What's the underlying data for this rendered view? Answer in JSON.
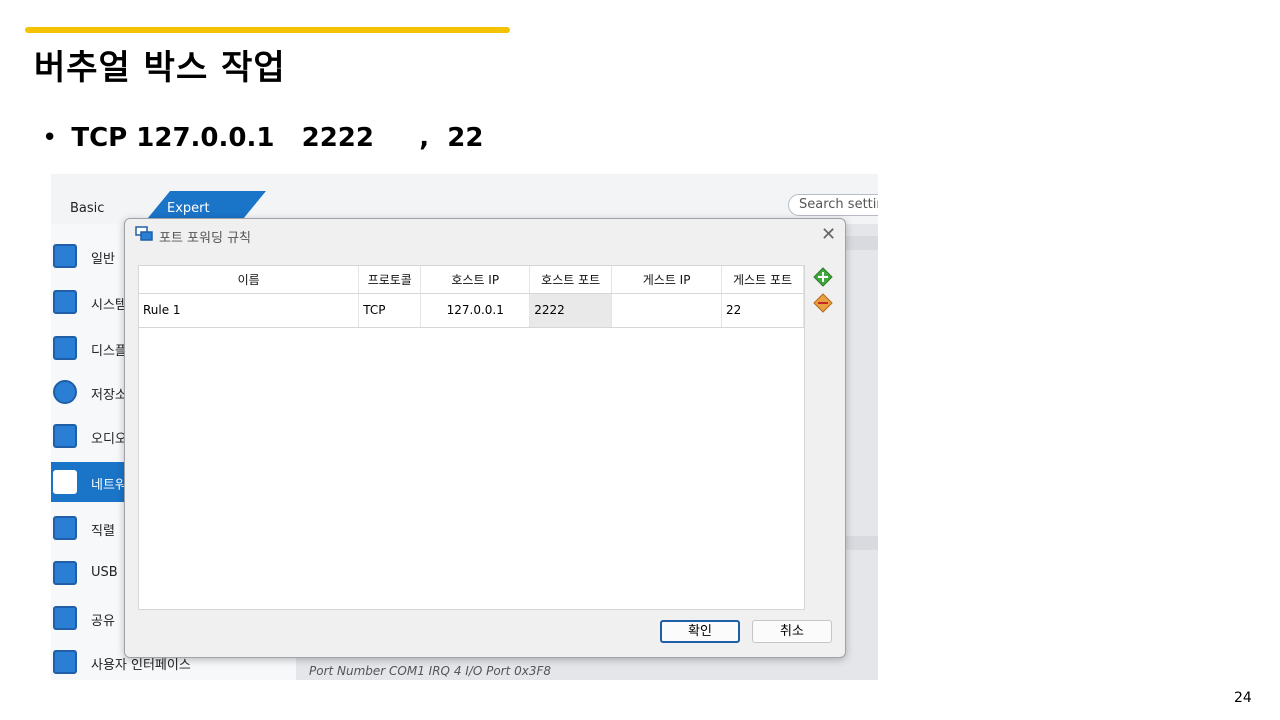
{
  "slide": {
    "title": "버추얼 박스 작업",
    "bullet_protocol": "TCP 127.0.0.1",
    "bullet_host_port": "2222",
    "bullet_sep": ",",
    "bullet_guest_port": "22",
    "page_number": "24"
  },
  "app": {
    "tabs": {
      "basic": "Basic",
      "expert": "Expert"
    },
    "search_placeholder": "Search settin",
    "sidebar": [
      {
        "label": "일반"
      },
      {
        "label": "시스템"
      },
      {
        "label": "디스플"
      },
      {
        "label": "저장소"
      },
      {
        "label": "오디오"
      },
      {
        "label": "네트워"
      },
      {
        "label": "직렬 "
      },
      {
        "label": "USB"
      },
      {
        "label": "공유 "
      },
      {
        "label": "사용자 인터페이스"
      }
    ],
    "bottom_text": "Port Number  COM1      IRQ  4   I/O Port  0x3F8"
  },
  "dialog": {
    "title": "포트 포워딩 규칙",
    "columns": [
      "이름",
      "프로토콜",
      "호스트 IP",
      "호스트 포트",
      "게스트 IP",
      "게스트 포트"
    ],
    "rows": [
      {
        "name": "Rule 1",
        "protocol": "TCP",
        "host_ip": "127.0.0.1",
        "host_port": "2222",
        "guest_ip": "",
        "guest_port": "22"
      }
    ],
    "ok_label": "확인",
    "cancel_label": "취소"
  },
  "colors": {
    "accent": "#f5c200",
    "selection": "#1a74c8"
  }
}
